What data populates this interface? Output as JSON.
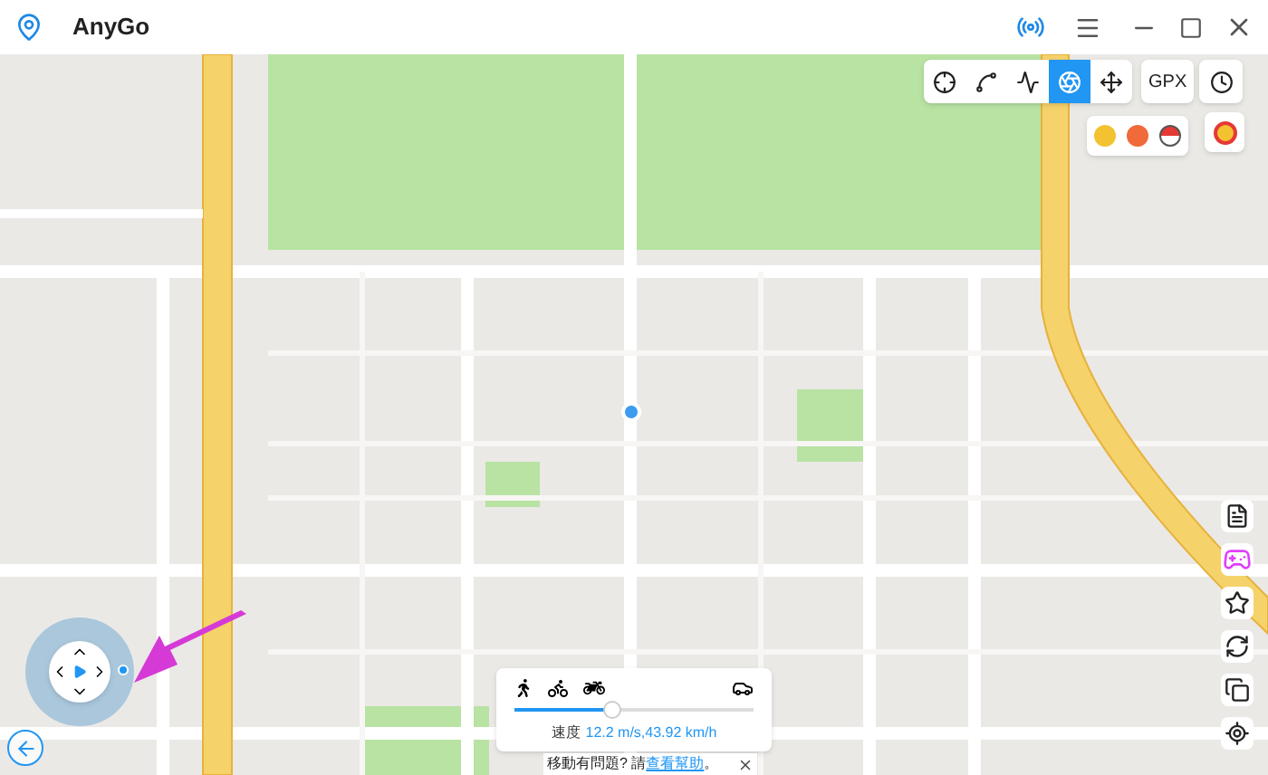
{
  "window": {
    "title": "AnyGo"
  },
  "modes": [
    {
      "kind": "teleport",
      "selected": false
    },
    {
      "kind": "two-spot",
      "selected": false
    },
    {
      "kind": "multi-spot",
      "selected": false
    },
    {
      "kind": "jump",
      "selected": true
    },
    {
      "kind": "joystick",
      "selected": false
    }
  ],
  "gpx_button": "GPX",
  "speed_panel": {
    "level": 0.41,
    "label": "速度",
    "reading": "12.2 m/s,43.92 km/h"
  },
  "hint": {
    "text": "移動有問題? 請",
    "link": "查看幫助",
    "end": "。"
  }
}
